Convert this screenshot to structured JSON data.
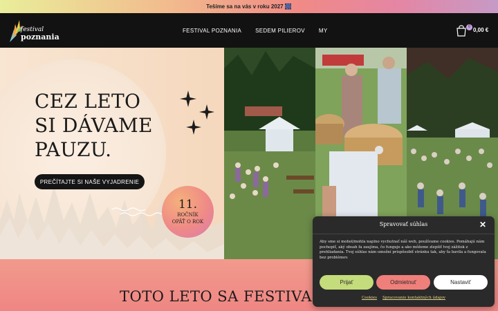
{
  "announcement": {
    "text": "Tešíme sa na vás v roku 2027 🎆"
  },
  "header": {
    "logo": {
      "line1": "festival",
      "line2": "poznania"
    },
    "nav": [
      {
        "label": "FESTIVAL POZNANIA"
      },
      {
        "label": "SEDEM PILIEROV"
      },
      {
        "label": "MY"
      }
    ],
    "cart": {
      "count": "0",
      "total": "0,00 €",
      "icon": "shopping-bag-icon"
    }
  },
  "hero": {
    "headline": [
      "CEZ LETO",
      "SI DÁVAME",
      "PAUZU."
    ],
    "cta_label": "PREČÍTAJTE SI NAŠE VYJADRENIE",
    "badge": {
      "number": "11.",
      "line1": "ROČNÍK",
      "line2": "OPÄŤ O ROK"
    },
    "icons": [
      "sparkle-icon",
      "wave-icon"
    ]
  },
  "section": {
    "heading": "TOTO LETO SA FESTIVAL PO"
  },
  "cookie_dialog": {
    "title": "Spravovať súhlas",
    "body": "Aby sme si mohol/mohla naplno vychutnať náš web, používame cookies. Pomáhajú nám pochopiť, aký obsah fa zaujíma, čo funguje a ako môžeme zlepšiť tvoj zážitok z prehliadania. Tvoj súhlas nám umožní prispôsobiť stránku tak, aby ťa bavila a fungovala bez problémov.",
    "accept_label": "Prijať",
    "deny_label": "Odmietnuť",
    "prefs_label": "Nastaviť",
    "links": [
      "Cookies",
      "Spracovanie kontaktných údajov"
    ]
  },
  "colors": {
    "header_bg": "#121212",
    "accept": "#c4dc7b",
    "deny": "#ef7f7a",
    "pink_section": "#ef8683",
    "cookie_bg": "#2a2a2a"
  }
}
